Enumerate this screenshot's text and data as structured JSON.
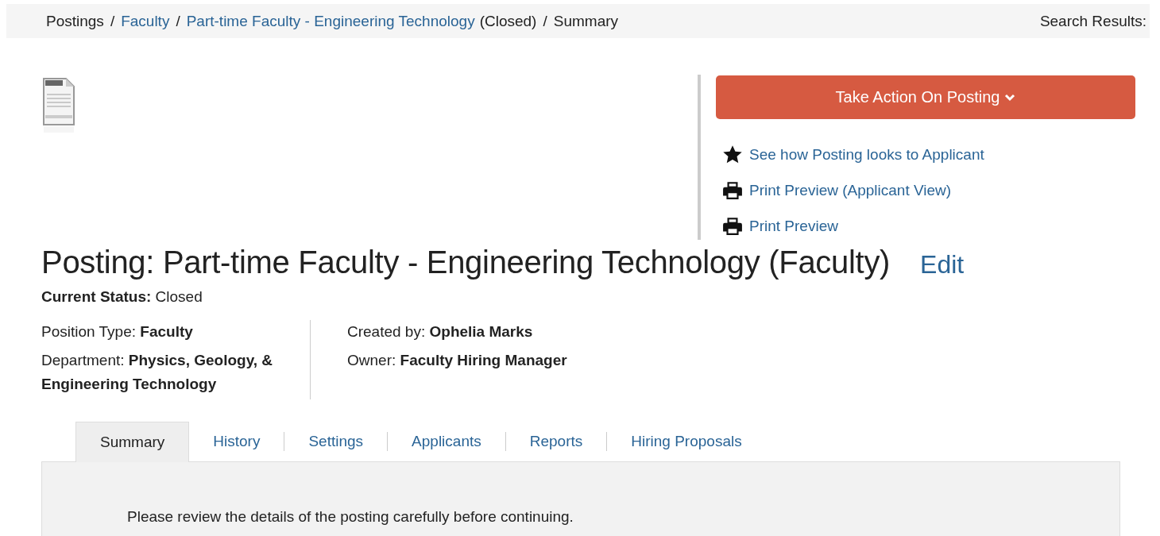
{
  "breadcrumb": [
    {
      "text": "Postings",
      "kind": "text"
    },
    {
      "text": "/",
      "kind": "separator"
    },
    {
      "text": "Faculty",
      "kind": "link"
    },
    {
      "text": "/",
      "kind": "separator"
    },
    {
      "text": "Part-time Faculty - Engineering Technology",
      "kind": "link"
    },
    {
      "text": "(Closed)",
      "kind": "text"
    },
    {
      "text": "/",
      "kind": "separator"
    },
    {
      "text": "Summary",
      "kind": "text"
    }
  ],
  "search_results": "Search Results:",
  "action_button": "Take Action On Posting",
  "action_links": [
    {
      "text": "See how Posting looks to Applicant",
      "kind": "star"
    },
    {
      "text": "Print Preview (Applicant View)",
      "kind": "print"
    },
    {
      "text": "Print Preview",
      "kind": "print"
    }
  ],
  "title": "Posting: Part-time Faculty - Engineering Technology (Faculty)",
  "edit_link": "Edit",
  "status": {
    "label": "Current Status:",
    "value": "Closed"
  },
  "details_left": [
    {
      "label": "Position Type:",
      "value": "Faculty"
    },
    {
      "label": "Department:",
      "value": "Physics, Geology, & Engineering Technology"
    }
  ],
  "details_right": [
    {
      "label": "Created by:",
      "value": "Ophelia Marks"
    },
    {
      "label": "Owner:",
      "value": "Faculty Hiring Manager"
    }
  ],
  "tabs": [
    {
      "label": "Summary",
      "selected": true
    },
    {
      "label": "History",
      "selected": false
    },
    {
      "label": "Settings",
      "selected": false
    },
    {
      "label": "Applicants",
      "selected": false
    },
    {
      "label": "Reports",
      "selected": false
    },
    {
      "label": "Hiring Proposals",
      "selected": false
    }
  ],
  "panel_text": "Please review the details of the posting carefully before continuing."
}
